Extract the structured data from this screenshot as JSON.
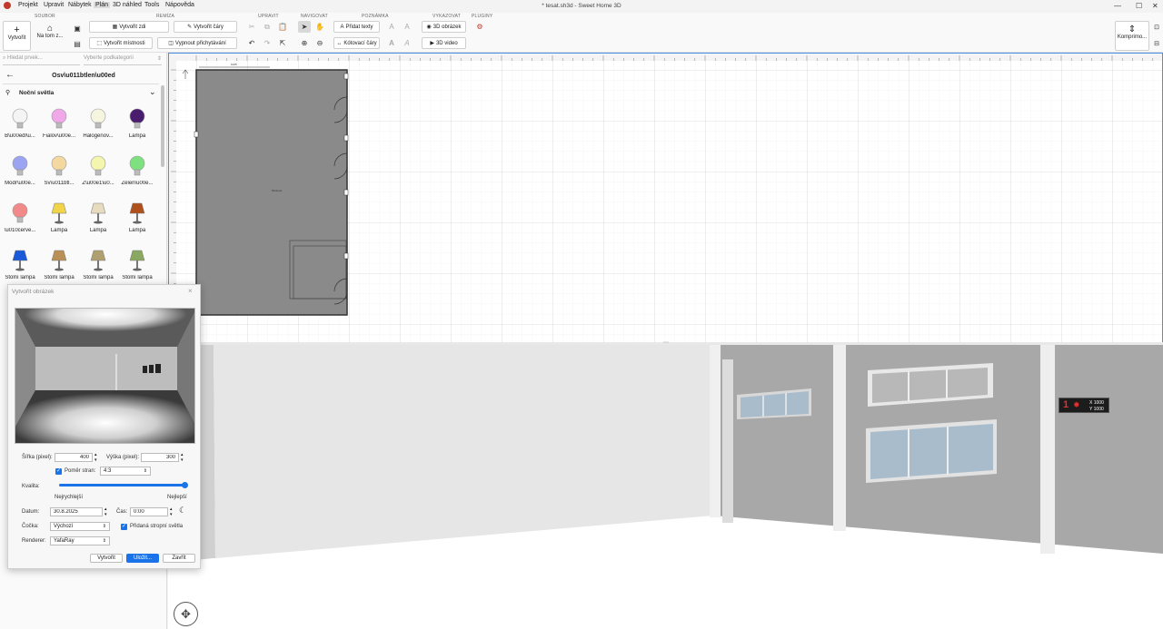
{
  "app": {
    "title": "* tesat.sh3d - Sweet Home 3D",
    "menu": [
      "Projekt",
      "Upravit",
      "Nábytek",
      "Plán",
      "3D náhled",
      "Tools",
      "Nápověda"
    ],
    "active_menu": "Plán"
  },
  "ribbon": {
    "groups": {
      "soubor": "SOUBOR",
      "remiza": "REMÍZA",
      "upravit": "UPRAVIT",
      "navigovat": "NAVIGOVAT",
      "poznamka": "POZNÁMKA",
      "vykazovat": "VYKAZOVAT",
      "pluginy": "PLUGINY"
    },
    "create_label": "Vytvořit",
    "on_this_label": "Na tom z...",
    "create_walls": "Vytvořit zdi",
    "create_lines": "Vytvořit čáry",
    "create_rooms": "Vytvořit místnosti",
    "disable_snapping": "Vypnout přichytávání",
    "add_text": "Přidat texty",
    "dimension_lines": "Kótovací čáry",
    "image_3d": "3D obrázek",
    "video_3d": "3D video",
    "compress_label": "Komprimo..."
  },
  "sidebar": {
    "search_placeholder": "Hledat prvek...",
    "subcategory_placeholder": "Vyberte podkategorii",
    "category_title": "Osv\\u011btlen\\u00ed",
    "subcategory": "Noční světla",
    "items": [
      {
        "label": "B\\u00edl\\u...",
        "color": "#f4f4f4"
      },
      {
        "label": "Fialov\\u00e...",
        "color": "#f0a8e8"
      },
      {
        "label": "Halogenov...",
        "color": "#f6f6e0"
      },
      {
        "label": "Lampa",
        "color": "#4a1c6e"
      },
      {
        "label": "Modr\\u00e...",
        "color": "#9aa4f0"
      },
      {
        "label": "Sv\\u011btl...",
        "color": "#f3d9a0"
      },
      {
        "label": "Z\\u00e1\\u0...",
        "color": "#f4f6b0"
      },
      {
        "label": "Zelen\\u00e...",
        "color": "#7ee07e"
      },
      {
        "label": "\\u010cerve...",
        "color": "#f28a8a"
      },
      {
        "label": "Lampa",
        "color": "#f2d44a"
      },
      {
        "label": "Lampa",
        "color": "#e8dcc0"
      },
      {
        "label": "Lampa",
        "color": "#b0501c"
      },
      {
        "label": "Stolní lampa",
        "color": "#1a5ad8"
      },
      {
        "label": "Stolní lampa",
        "color": "#b89058"
      },
      {
        "label": "Stolní lampa",
        "color": "#b0a070"
      },
      {
        "label": "Stolní lampa",
        "color": "#8aa860"
      }
    ]
  },
  "plan": {
    "room_label": "Místnost",
    "top_dim": "1025"
  },
  "view3d": {
    "coords_x": "X 1000",
    "coords_y": "Y 1000",
    "counter": "1"
  },
  "dialog": {
    "title": "Vytvořit obrázek",
    "width_label": "Šířka (pixel):",
    "width_value": "400",
    "height_label": "Výška (pixel):",
    "height_value": "300",
    "ratio_label": "Poměr stran:",
    "ratio_value": "4:3",
    "quality_label": "Kvalita:",
    "quality_fraction": 1.0,
    "quality_min": "Nejrychlejší",
    "quality_max": "Nejlepší",
    "date_label": "Datum:",
    "date_value": "30.8.2025",
    "time_label": "Čas:",
    "time_value": "0:00",
    "lens_label": "Čočka:",
    "lens_value": "Výchozí",
    "ceiling_lights_label": "Přidaná stropní světla",
    "renderer_label": "Renderer:",
    "renderer_value": "YafaRay",
    "create_btn": "Vytvořit",
    "save_btn": "Uložit...",
    "close_btn": "Zavřít"
  }
}
